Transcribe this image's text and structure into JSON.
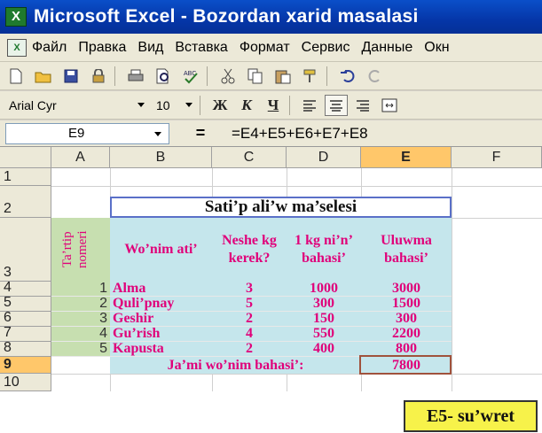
{
  "window": {
    "title": "Microsoft Excel - Bozordan xarid masalasi",
    "logo": "excel-icon"
  },
  "menu": [
    "Файл",
    "Правка",
    "Вид",
    "Вставка",
    "Формат",
    "Сервис",
    "Данные",
    "Окн"
  ],
  "formatting": {
    "font": "Arial Cyr",
    "size": "10",
    "bold": "Ж",
    "italic": "К",
    "underline": "Ч"
  },
  "formula_bar": {
    "cell_ref": "E9",
    "eq": "=",
    "formula": "=E4+E5+E6+E7+E8"
  },
  "columns": [
    "A",
    "B",
    "C",
    "D",
    "E",
    "F"
  ],
  "rows": [
    "1",
    "2",
    "3",
    "4",
    "5",
    "6",
    "7",
    "8",
    "9",
    "10"
  ],
  "sheet": {
    "title": "Sati’p  ali’w  ma’selesi",
    "vertical_header": "Ta’rtip nomeri",
    "headers": [
      "Wo’nim ati’",
      "Neshe kg kerek?",
      "1 kg ni’n’ bahasi’",
      "Uluwma bahasi’"
    ],
    "items": [
      {
        "n": "1",
        "name": "Alma",
        "kg": "3",
        "price": "1000",
        "total": "3000"
      },
      {
        "n": "2",
        "name": "Quli’pnay",
        "kg": "5",
        "price": "300",
        "total": "1500"
      },
      {
        "n": "3",
        "name": "Geshir",
        "kg": "2",
        "price": "150",
        "total": "300"
      },
      {
        "n": "4",
        "name": "Gu’rish",
        "kg": "4",
        "price": "550",
        "total": "2200"
      },
      {
        "n": "5",
        "name": "Kapusta",
        "kg": "2",
        "price": "400",
        "total": "800"
      }
    ],
    "total_label": "Ja’mi wo’nim bahasi’:",
    "total_value": "7800"
  },
  "caption": "E5- su’wret",
  "colors": {
    "accent_text": "#e0007a",
    "teal": "#c5e6ec",
    "green": "#c7dfb0",
    "selected_header": "#ffc76a"
  }
}
